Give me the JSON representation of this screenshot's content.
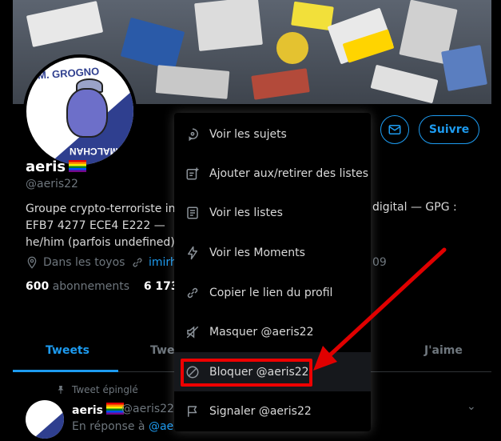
{
  "banner": {
    "description_icon": "stickers-banner"
  },
  "profile": {
    "avatar_text_top": "M. GROGNO",
    "avatar_text_bottom": "E MALCHAN",
    "name": "aeris",
    "handle": "@aeris22",
    "bio_line1": "Groupe crypto-terroriste ind",
    "bio_right": "digital — GPG :",
    "bio_line2": "EFB7 4277 ECE4 E222 —",
    "bio_line3": "he/him (parfois undefined)",
    "location": "Dans les toyos",
    "website": "imirh",
    "joined_partial": "09",
    "following_count": "600",
    "following_label": "abonnements",
    "followers_count": "6 173",
    "followers_partial": "a",
    "follow_button": "Suivre"
  },
  "tabs": {
    "tweets": "Tweets",
    "replies_partial": "Twe",
    "likes": "J'aime"
  },
  "tweet": {
    "pinned_label": "Tweet épinglé",
    "author_name": "aeris",
    "author_handle": "@aeris22",
    "reply_prefix": "En réponse à",
    "reply_handle": "@aeri"
  },
  "menu": {
    "items": [
      {
        "label": "Voir les sujets",
        "icon": "topic-icon"
      },
      {
        "label": "Ajouter aux/retirer des listes",
        "icon": "list-add-icon"
      },
      {
        "label": "Voir les listes",
        "icon": "list-icon"
      },
      {
        "label": "Voir les Moments",
        "icon": "lightning-icon"
      },
      {
        "label": "Copier le lien du profil",
        "icon": "link-icon"
      },
      {
        "label": "Masquer @aeris22",
        "icon": "mute-icon"
      },
      {
        "label": "Bloquer @aeris22",
        "icon": "block-icon"
      },
      {
        "label": "Signaler @aeris22",
        "icon": "flag-icon"
      }
    ]
  },
  "colors": {
    "accent": "#1d9bf0",
    "annotation": "#e00000",
    "background": "#000000"
  }
}
